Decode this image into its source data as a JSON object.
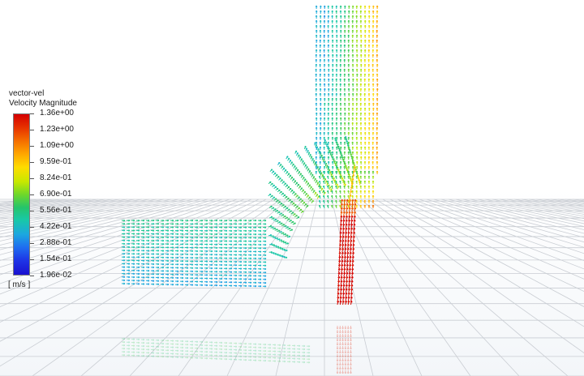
{
  "legend": {
    "title": "vector-vel",
    "quantity": "Velocity Magnitude",
    "unit": "[ m/s ]",
    "levels": [
      "1.36e+00",
      "1.23e+00",
      "1.09e+00",
      "9.59e-01",
      "8.24e-01",
      "6.90e-01",
      "5.56e-01",
      "4.22e-01",
      "2.88e-01",
      "1.54e-01",
      "1.96e-02"
    ],
    "max_value": 1.36,
    "min_value": 0.0196
  },
  "colormap": [
    "#1a10d0",
    "#1e35e6",
    "#1f6df0",
    "#1ca6e0",
    "#18c8a8",
    "#26c46a",
    "#6fd82a",
    "#c8e800",
    "#ffdc00",
    "#ffa800",
    "#f46a00",
    "#e63000",
    "#d40000"
  ],
  "scene": {
    "grid_color": "#c9cdd3",
    "background_color": "#ffffff"
  }
}
